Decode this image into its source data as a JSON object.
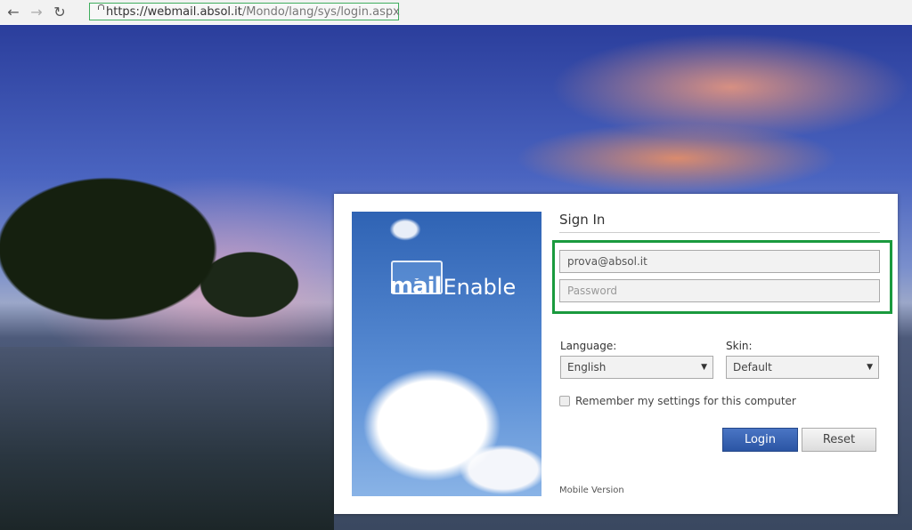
{
  "browser": {
    "back_icon": "arrow-left",
    "forward_icon": "arrow-right",
    "reload_icon": "reload",
    "url_host": "https://webmail.absol.it",
    "url_path": "/Mondo/lang/sys/login.aspx"
  },
  "logo": {
    "mail": "mail",
    "enable": "Enable"
  },
  "signin": {
    "title": "Sign In",
    "email_value": "prova@absol.it",
    "password_placeholder": "Password",
    "language_label": "Language:",
    "language_value": "English",
    "skin_label": "Skin:",
    "skin_value": "Default",
    "remember_label": "Remember my settings for this computer",
    "remember_checked": false,
    "login_label": "Login",
    "reset_label": "Reset",
    "mobile_link": "Mobile Version"
  },
  "colors": {
    "highlight": "#1a9a3e",
    "login_button": "#2b55a4"
  }
}
